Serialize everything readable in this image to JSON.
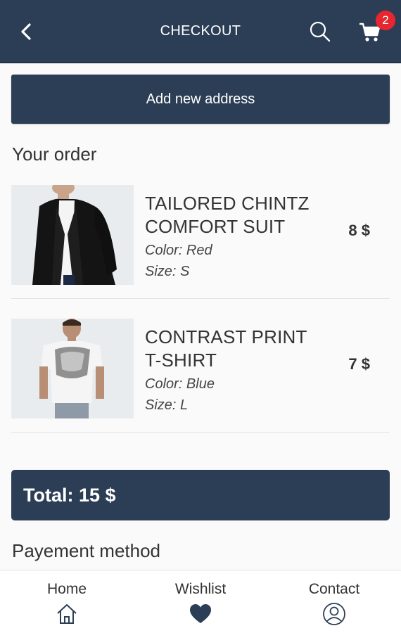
{
  "header": {
    "title": "CHECKOUT",
    "cart_count": "2",
    "icons": [
      "back-arrow-icon",
      "search-icon",
      "cart-icon"
    ]
  },
  "address_button": {
    "label": "Add new address"
  },
  "order": {
    "title": "Your order",
    "items": [
      {
        "name_line1": "TAILORED CHINTZ",
        "name_line2": "COMFORT SUIT",
        "color": "Color: Red",
        "size": "Size: S",
        "price": "8 $"
      },
      {
        "name_line1": "CONTRAST PRINT",
        "name_line2": "T-SHIRT",
        "color": "Color: Blue",
        "size": "Size: L",
        "price": "7 $"
      }
    ]
  },
  "total": {
    "label": "Total: 15 $"
  },
  "payment": {
    "title": "Payement method"
  },
  "bottom_nav": {
    "items": [
      {
        "label": "Home",
        "icon": "home-icon"
      },
      {
        "label": "Wishlist",
        "icon": "heart-icon"
      },
      {
        "label": "Contact",
        "icon": "user-icon"
      }
    ]
  },
  "colors": {
    "primary": "#2c3e55",
    "badge": "#e7262f",
    "background": "#fafafa"
  }
}
